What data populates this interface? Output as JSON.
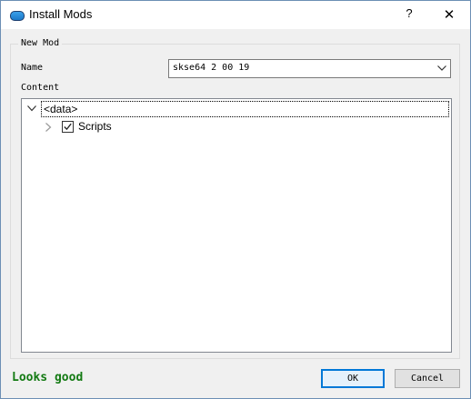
{
  "window": {
    "title": "Install Mods",
    "help_label": "?",
    "close_label": "✕"
  },
  "group": {
    "title": "New Mod"
  },
  "name_field": {
    "label": "Name",
    "value": "skse64 2 00 19"
  },
  "content": {
    "label": "Content",
    "tree": {
      "root": {
        "label": "<data>",
        "expanded": true
      },
      "children": [
        {
          "label": "Scripts",
          "checked": true,
          "expanded": false
        }
      ]
    }
  },
  "status": {
    "text": "Looks good",
    "color": "#137a13"
  },
  "buttons": {
    "ok_label": "OK",
    "cancel_label": "Cancel"
  },
  "colors": {
    "accent": "#0078d7"
  }
}
